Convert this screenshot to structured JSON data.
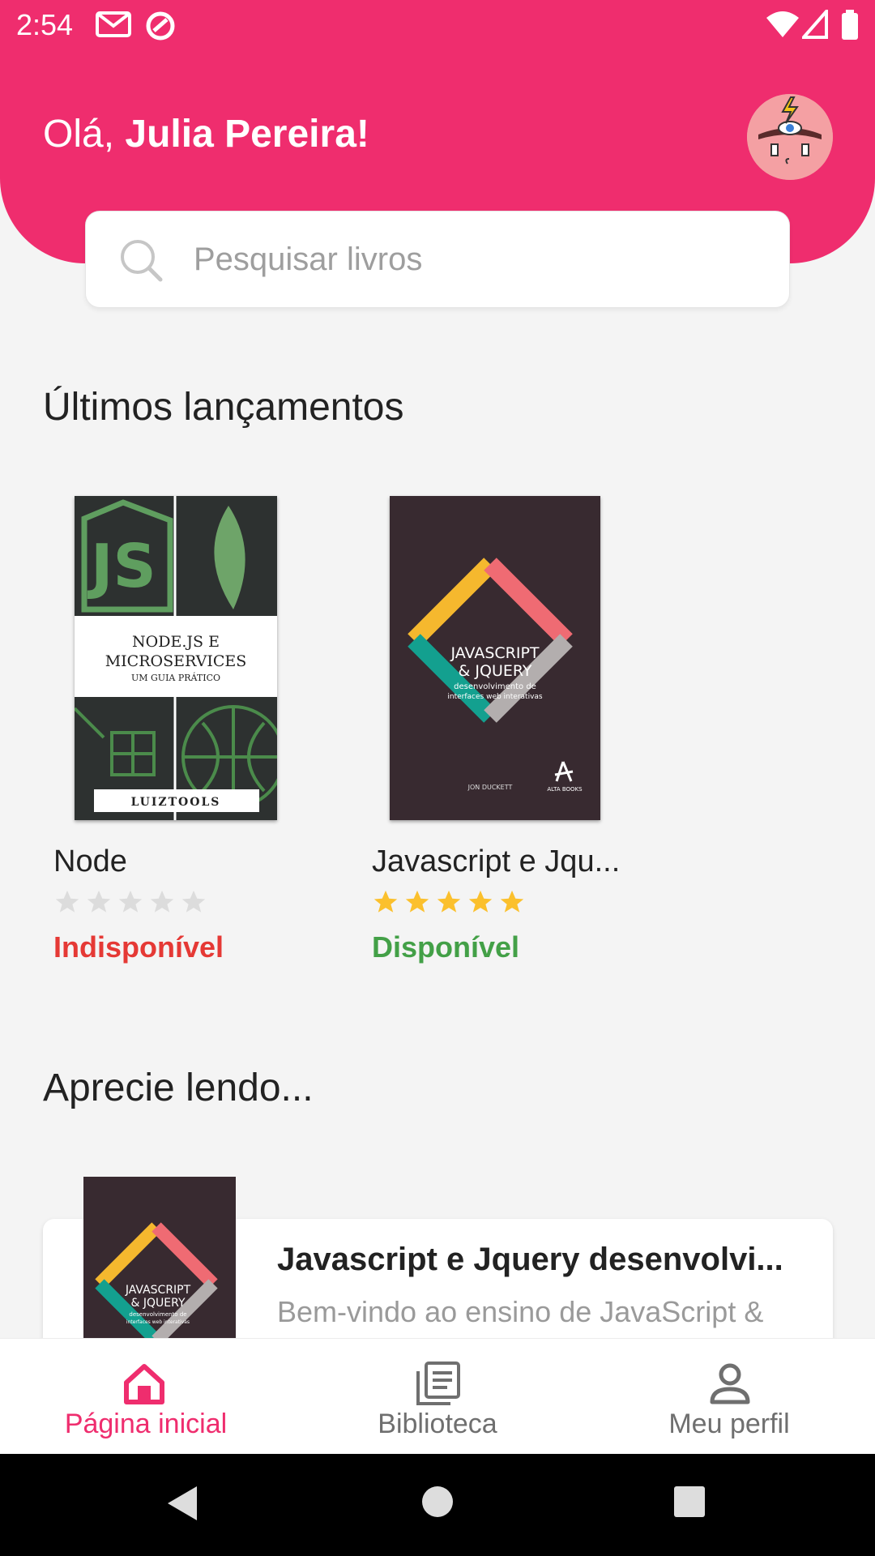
{
  "status_bar": {
    "time": "2:54"
  },
  "header": {
    "greeting_prefix": "Olá, ",
    "user_name": "Julia Pereira!"
  },
  "search": {
    "placeholder": "Pesquisar livros"
  },
  "sections": {
    "latest": "Últimos lançamentos",
    "enjoy": "Aprecie lendo..."
  },
  "books": [
    {
      "title": "Node",
      "rating": 0,
      "max_rating": 5,
      "status": "Indisponível",
      "status_color": "#e53935",
      "cover": {
        "line1": "NODE.JS E",
        "line2": "MICROSERVICES",
        "line3": "UM GUIA PRÁTICO",
        "publisher": "LUIZTOOLS",
        "logo": "JS"
      }
    },
    {
      "title": "Javascript e Jqu...",
      "rating": 5,
      "max_rating": 5,
      "status": "Disponível",
      "status_color": "#43a047",
      "cover": {
        "line1": "JAVASCRIPT",
        "line2": "& JQUERY",
        "line3": "desenvolvimento de",
        "line4": "interfaces web interativas",
        "author": "JON DUCKETT",
        "publisher": "ALTA BOOKS"
      }
    }
  ],
  "featured": {
    "title": "Javascript e Jquery desenvolvi...",
    "description": "Bem-vindo ao ensino de JavaScript & jQuery. Você irá iniciar sua jornada"
  },
  "bottom_nav": [
    {
      "label": "Página inicial",
      "icon": "home-icon",
      "active": true
    },
    {
      "label": "Biblioteca",
      "icon": "library-icon",
      "active": false
    },
    {
      "label": "Meu perfil",
      "icon": "profile-icon",
      "active": false
    }
  ],
  "colors": {
    "brand": "#ef2d6e",
    "star_filled": "#fbc02d",
    "star_empty": "#dcdcdc",
    "nav_inactive": "#6f6f6f"
  }
}
